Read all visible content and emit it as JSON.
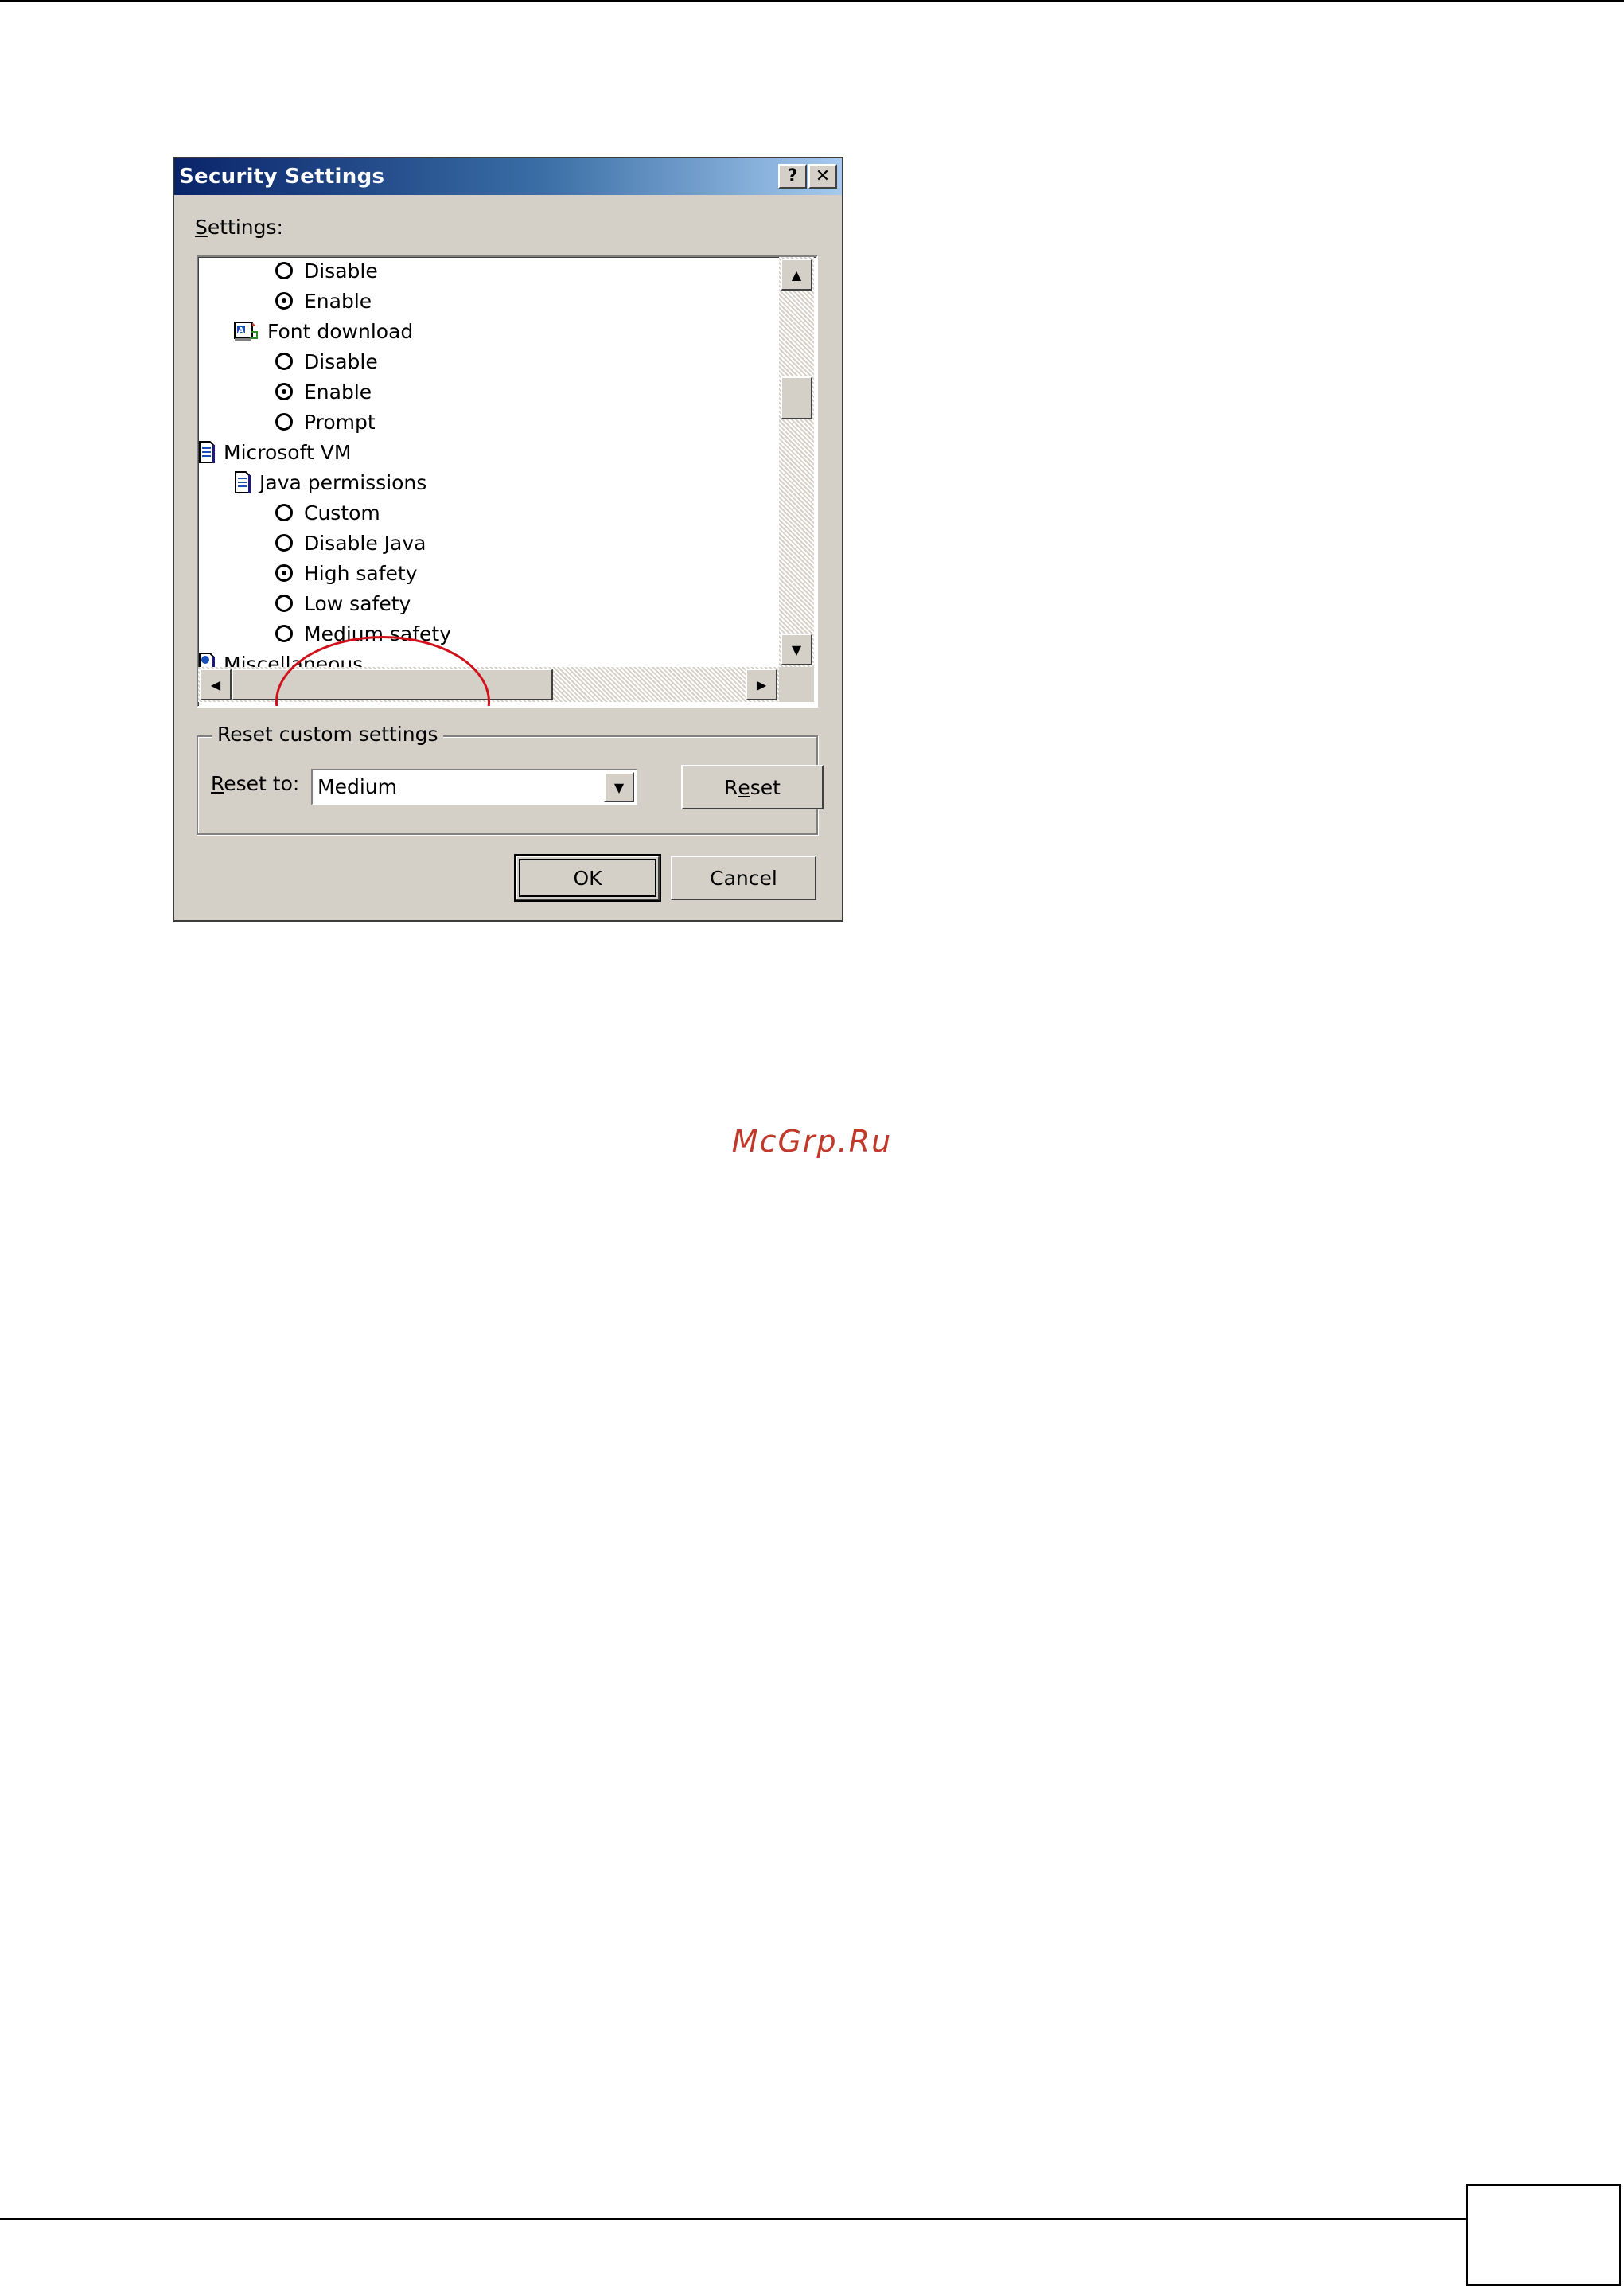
{
  "dialog": {
    "title": "Security Settings",
    "help_glyph": "?",
    "close_glyph": "✕",
    "settings_label_underlined": "S",
    "settings_label_rest": "ettings:"
  },
  "settings_list": {
    "items": [
      {
        "label": "Disable",
        "kind": "radio",
        "checked": false
      },
      {
        "label": "Enable",
        "kind": "radio",
        "checked": true
      },
      {
        "label": "Font download",
        "kind": "category"
      },
      {
        "label": "Disable",
        "kind": "radio",
        "checked": false
      },
      {
        "label": "Enable",
        "kind": "radio",
        "checked": true
      },
      {
        "label": "Prompt",
        "kind": "radio",
        "checked": false
      },
      {
        "label": "Microsoft VM",
        "kind": "category"
      },
      {
        "label": "Java permissions",
        "kind": "category"
      },
      {
        "label": "Custom",
        "kind": "radio",
        "checked": false
      },
      {
        "label": "Disable Java",
        "kind": "radio",
        "checked": false
      },
      {
        "label": "High safety",
        "kind": "radio",
        "checked": true
      },
      {
        "label": "Low safety",
        "kind": "radio",
        "checked": false
      },
      {
        "label": "Medium safety",
        "kind": "radio",
        "checked": false
      },
      {
        "label": "Miscellaneous",
        "kind": "category"
      }
    ]
  },
  "reset_group": {
    "legend": "Reset custom settings",
    "label_underlined": "R",
    "label_rest": "eset to:",
    "selected_value": "Medium",
    "reset_button_pre": "R",
    "reset_button_underlined": "e",
    "reset_button_post": "set"
  },
  "footer": {
    "ok_label": "OK",
    "cancel_label": "Cancel"
  },
  "watermark": "McGrp.Ru",
  "colors": {
    "title_gradient_start": "#0a246a",
    "title_gradient_end": "#a6caf0",
    "dialog_face": "#d4d0c8",
    "highlight_circle": "#d0101a",
    "watermark": "#c0392b"
  }
}
